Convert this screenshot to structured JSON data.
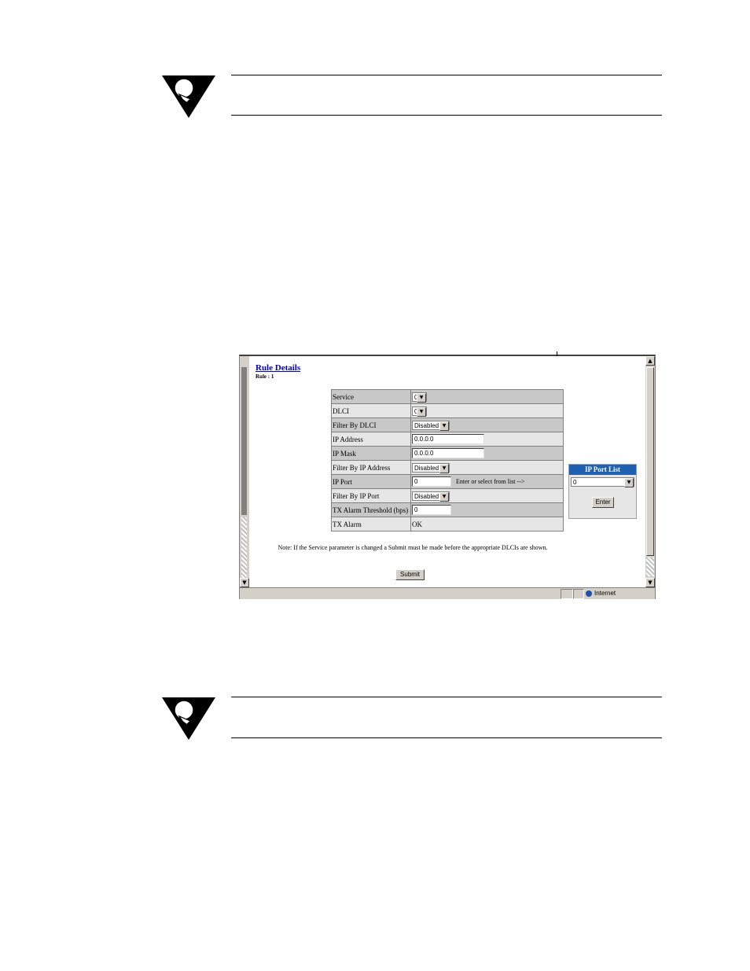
{
  "window": {
    "status_zone": "Internet"
  },
  "rule_details": {
    "title": "Rule Details",
    "subtitle": "Rule : 1"
  },
  "params": {
    "service": {
      "label": "Service",
      "value": "0"
    },
    "dlci": {
      "label": "DLCI",
      "value": "0"
    },
    "filter_by_dlci": {
      "label": "Filter By DLCI",
      "value": "Disabled"
    },
    "ip_address": {
      "label": "IP Address",
      "value": "0.0.0.0"
    },
    "ip_mask": {
      "label": "IP Mask",
      "value": "0.0.0.0"
    },
    "filter_by_ip_address": {
      "label": "Filter By IP Address",
      "value": "Disabled"
    },
    "ip_port": {
      "label": "IP Port",
      "value": "0",
      "hint": "Enter or select from list -->"
    },
    "filter_by_ip_port": {
      "label": "Filter By IP Port",
      "value": "Disabled"
    },
    "tx_alarm_threshold": {
      "label": "TX Alarm Threshold (bps)",
      "value": "0"
    },
    "tx_alarm": {
      "label": "TX Alarm",
      "value": "OK"
    }
  },
  "note": "Note:  If the Service parameter is changed a Submit must be made before the appropriate DLCIs are shown.",
  "submit_label": "Submit",
  "ip_port_list": {
    "title": "IP Port List",
    "selected": "0",
    "enter_label": "Enter"
  },
  "colors": {
    "link": "#0000cc",
    "header_blue": "#2060b0",
    "row_dark": "#c8c8c8",
    "row_light": "#e6e6e6"
  },
  "icons": [
    "lightbulb-tip-icon",
    "scroll-up-icon",
    "scroll-down-icon",
    "globe-icon",
    "dropdown-arrow-icon"
  ]
}
